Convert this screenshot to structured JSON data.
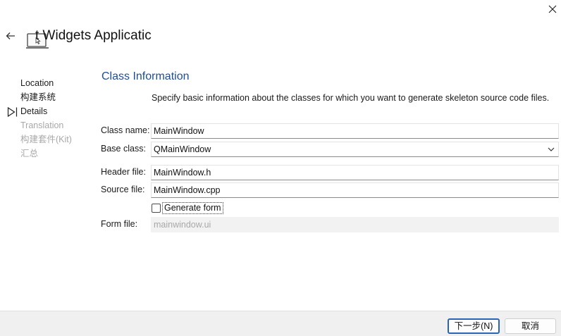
{
  "window": {
    "title": "t Widgets Applicatic"
  },
  "icons": {
    "close": "close-icon",
    "back": "back-arrow-icon",
    "app": "laptop-app-icon",
    "current_step": "current-step-arrow-icon",
    "dropdown": "chevron-down-icon"
  },
  "steps": [
    {
      "label": "Location",
      "state": "done"
    },
    {
      "label": "构建系统",
      "state": "done"
    },
    {
      "label": "Details",
      "state": "current"
    },
    {
      "label": "Translation",
      "state": "pending"
    },
    {
      "label": "构建套件(Kit)",
      "state": "pending"
    },
    {
      "label": "汇总",
      "state": "pending"
    }
  ],
  "page": {
    "section_title": "Class Information",
    "description": "Specify basic information about the classes for which you want to generate skeleton source code files."
  },
  "form": {
    "class_name": {
      "label": "Class name:",
      "value": "MainWindow"
    },
    "base_class": {
      "label": "Base class:",
      "value": "QMainWindow"
    },
    "header_file": {
      "label": "Header file:",
      "value": "MainWindow.h"
    },
    "source_file": {
      "label": "Source file:",
      "value": "MainWindow.cpp"
    },
    "generate_form": {
      "label": "Generate form",
      "checked": false
    },
    "form_file": {
      "label": "Form file:",
      "value": "mainwindow.ui",
      "enabled": false
    }
  },
  "footer": {
    "next_label": "下一步(N)",
    "cancel_label": "取消"
  },
  "colors": {
    "accent": "#1f4e96",
    "primary_button_border": "#2b63b8",
    "disabled_text": "#a8a8a8",
    "footer_bg": "#f0f0f0"
  }
}
